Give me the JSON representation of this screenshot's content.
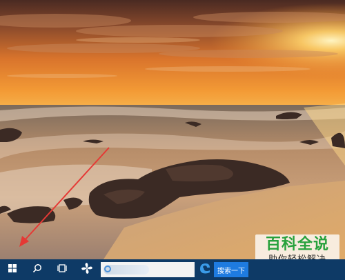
{
  "taskbar": {
    "start_icon": "windows-logo-icon",
    "search_icon": "cortana-search-icon",
    "task_view_icon": "task-view-icon",
    "pinwheel_icon": "pinwheel-app-icon",
    "search_button_label": "搜索一下",
    "search_placeholder": "",
    "apps": [
      {
        "icon": "edge-browser-icon"
      },
      {
        "icon": "file-explorer-icon"
      }
    ]
  },
  "watermark": {
    "title": "百科全说",
    "subtitle": "助你轻松解决"
  },
  "colors": {
    "taskbar": "#0e3a66",
    "search_button": "#1e7be0",
    "watermark_green": "#27a13c",
    "arrow_red": "#e53935"
  }
}
